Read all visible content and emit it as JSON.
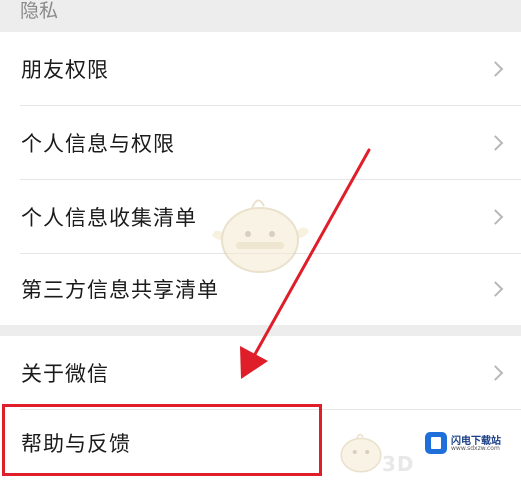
{
  "section": {
    "title": "隐私"
  },
  "privacy_items": [
    {
      "label": "朋友权限"
    },
    {
      "label": "个人信息与权限"
    },
    {
      "label": "个人信息收集清单"
    },
    {
      "label": "第三方信息共享清单"
    }
  ],
  "about_items": [
    {
      "label": "关于微信"
    },
    {
      "label": "帮助与反馈"
    }
  ],
  "watermark": {
    "site_name": "闪电下载站",
    "site_url": "www.sdxzw.com",
    "mark_3d": "3D"
  },
  "colors": {
    "page_background": "#ededed",
    "row_background": "#ffffff",
    "annotation_red": "#e01e2a",
    "chevron": "#b8b8b8"
  },
  "icons": {
    "chevron": "chevron-right-icon",
    "annotation": "red-arrow-icon",
    "mascot": "mascot-watermark-icon"
  }
}
